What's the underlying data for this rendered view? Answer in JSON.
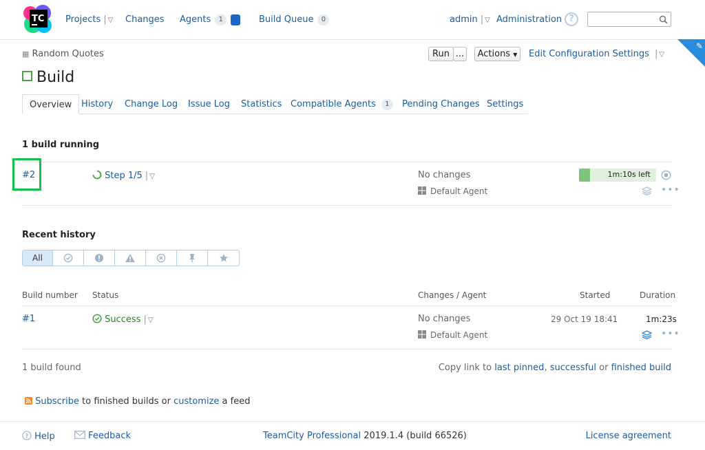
{
  "header": {
    "logo_text": "TC",
    "projects": "Projects",
    "changes": "Changes",
    "agents": "Agents",
    "agents_count": "1",
    "build_queue": "Build Queue",
    "build_queue_count": "0",
    "user": "admin",
    "administration": "Administration",
    "search_placeholder": ""
  },
  "breadcrumb": {
    "project": "Random Quotes"
  },
  "toolbar": {
    "run": "Run",
    "run_more": "...",
    "actions": "Actions",
    "edit_config": "Edit Configuration Settings"
  },
  "page_title": "Build",
  "tabs": [
    {
      "label": "Overview"
    },
    {
      "label": "History"
    },
    {
      "label": "Change Log"
    },
    {
      "label": "Issue Log"
    },
    {
      "label": "Statistics"
    },
    {
      "label": "Compatible Agents",
      "badge": "1"
    },
    {
      "label": "Pending Changes"
    },
    {
      "label": "Settings"
    }
  ],
  "running": {
    "title": "1 build running",
    "build_number": "#2",
    "step": "Step 1/5",
    "changes": "No changes",
    "agent": "Default Agent",
    "time_left": "1m:10s left",
    "progress_fraction": 0.14
  },
  "history": {
    "title": "Recent history",
    "filter_all": "All",
    "columns": {
      "build_number": "Build number",
      "status": "Status",
      "changes_agent": "Changes / Agent",
      "started": "Started",
      "duration": "Duration"
    },
    "rows": [
      {
        "number": "#1",
        "status": "Success",
        "changes": "No changes",
        "agent": "Default Agent",
        "started": "29 Oct 19 18:41",
        "duration": "1m:23s"
      }
    ],
    "found": "1 build found",
    "copy_link_prefix": "Copy link to",
    "last_pinned": "last pinned",
    "comma": ",",
    "successful": "successful",
    "or": "or",
    "finished_build": "finished build"
  },
  "feed": {
    "subscribe": "Subscribe",
    "text1": "to finished builds or",
    "customize": "customize",
    "text2": "a feed"
  },
  "footer": {
    "help": "Help",
    "feedback": "Feedback",
    "product": "TeamCity Professional",
    "version": "2019.1.4 (build 66526)",
    "license": "License agreement"
  },
  "colors": {
    "link": "#1a5c9e",
    "success": "#4ca044",
    "progress_fill": "#7cc57a",
    "accent": "#2b8bdc"
  }
}
